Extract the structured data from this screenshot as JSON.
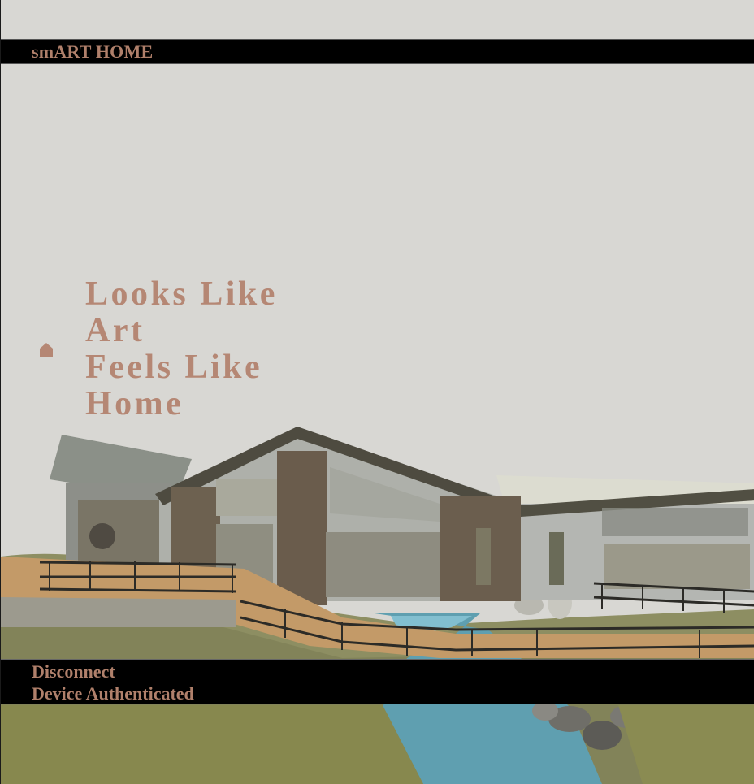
{
  "header": {
    "brand": "smART HOME"
  },
  "hero": {
    "icon": "home-icon",
    "headline_lines": [
      "Looks Like",
      "Art",
      "Feels Like",
      "Home"
    ]
  },
  "footer": {
    "disconnect_label": "Disconnect",
    "status_text": "Device Authenticated"
  },
  "colors": {
    "accent": "#b58774",
    "bar_background": "#000000",
    "page_background": "#d8d7d3"
  }
}
